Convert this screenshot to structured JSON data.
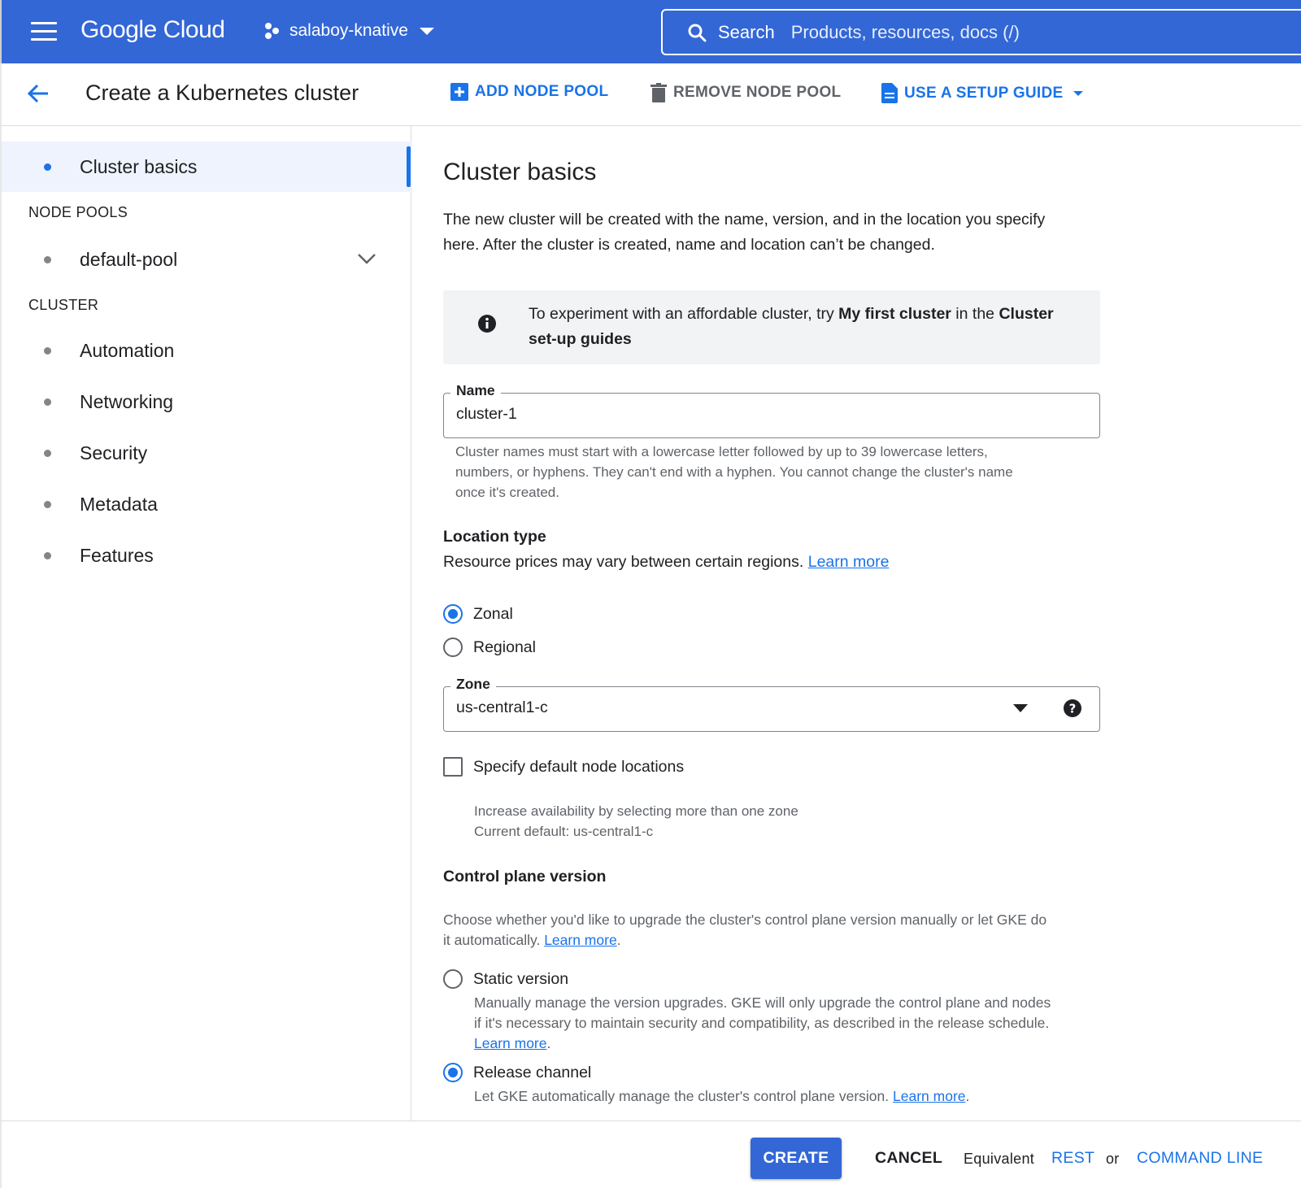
{
  "topbar": {
    "brand": "Google Cloud",
    "project": "salaboy-knative",
    "search_label": "Search",
    "search_placeholder": "Products, resources, docs (/)"
  },
  "header": {
    "title": "Create a Kubernetes cluster",
    "add_node_pool": "ADD NODE POOL",
    "remove_node_pool": "REMOVE NODE POOL",
    "setup_guide": "USE A SETUP GUIDE"
  },
  "sidebar": {
    "cluster_basics": "Cluster basics",
    "node_pools_header": "NODE POOLS",
    "default_pool": "default-pool",
    "cluster_header": "CLUSTER",
    "items": [
      "Automation",
      "Networking",
      "Security",
      "Metadata",
      "Features"
    ]
  },
  "main": {
    "title": "Cluster basics",
    "intro_1": "The new cluster will be created with the name, version, and in the location you specify",
    "intro_2": "here. After the cluster is created, name and location can’t be changed.",
    "info_pre": "To experiment with an affordable cluster, try ",
    "info_bold1": "My first cluster",
    "info_mid": " in the ",
    "info_bold2": "Cluster set-up guides",
    "name_label": "Name",
    "name_value": "cluster-1",
    "name_help_1": "Cluster names must start with a lowercase letter followed by up to 39 lowercase letters,",
    "name_help_2": "numbers, or hyphens. They can't end with a hyphen. You cannot change the cluster's name",
    "name_help_3": "once it's created.",
    "location_type_title": "Location type",
    "location_type_desc": "Resource prices may vary between certain regions.",
    "learn_more": "Learn more",
    "zonal": "Zonal",
    "regional": "Regional",
    "zone_label": "Zone",
    "zone_value": "us-central1-c",
    "specify_locations": "Specify default node locations",
    "availability_1": "Increase availability by selecting more than one zone",
    "availability_2": "Current default: us-central1-c",
    "cp_title": "Control plane version",
    "cp_desc_1": "Choose whether you'd like to upgrade the cluster's control plane version manually or let GKE do",
    "cp_desc_2": "it automatically.",
    "static_version": "Static version",
    "static_desc_1": "Manually manage the version upgrades. GKE will only upgrade the control plane and nodes",
    "static_desc_2": "if it's necessary to maintain security and compatibility, as described in the release schedule.",
    "release_channel": "Release channel",
    "release_desc": "Let GKE automatically manage the cluster's control plane version."
  },
  "footer": {
    "create": "CREATE",
    "cancel": "CANCEL",
    "equivalent": "Equivalent",
    "rest": "REST",
    "or": "or",
    "command_line": "COMMAND LINE"
  }
}
